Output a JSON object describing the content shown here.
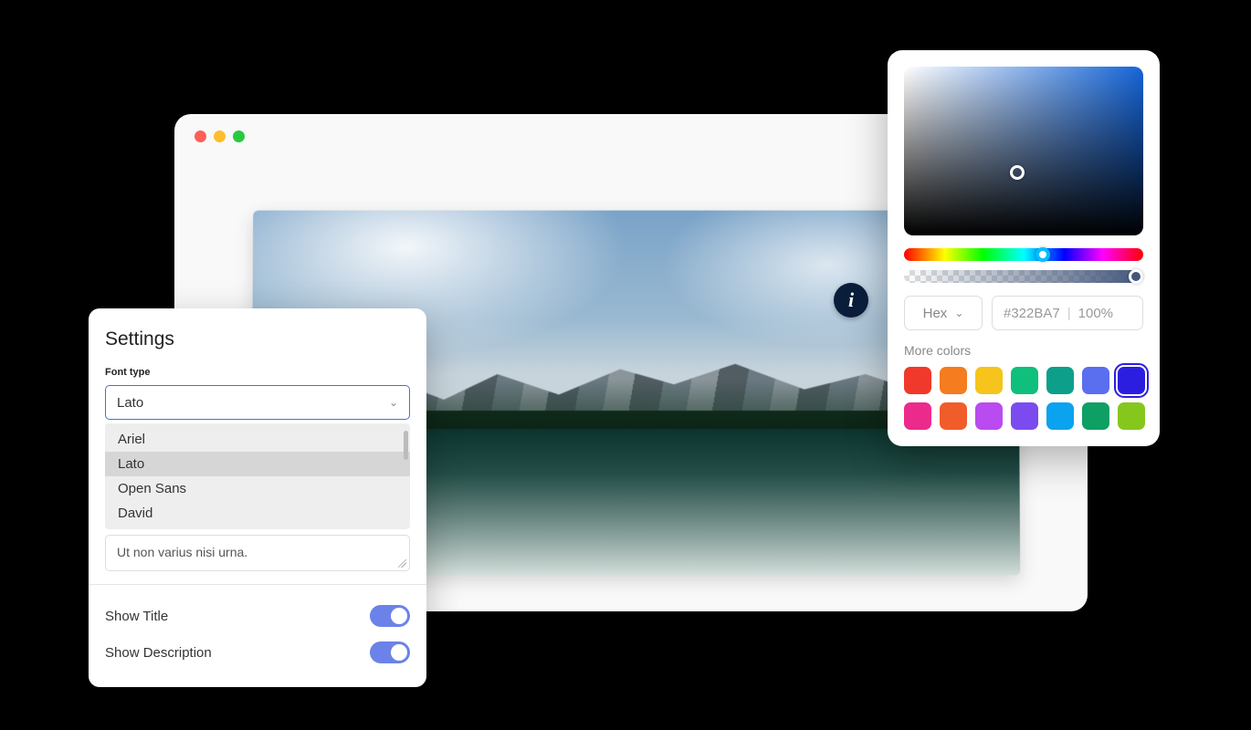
{
  "settings": {
    "title": "Settings",
    "font_type_label": "Font type",
    "font_selected": "Lato",
    "font_options": [
      "Ariel",
      "Lato",
      "Open Sans",
      "David"
    ],
    "textarea_value": "Ut non varius nisi urna.",
    "show_title_label": "Show Title",
    "show_title_on": true,
    "show_description_label": "Show Description",
    "show_description_on": true
  },
  "picker": {
    "format_label": "Hex",
    "hex_value": "#322BA7",
    "opacity": "100%",
    "more_colors_label": "More colors",
    "swatches_row1": [
      "#f0392b",
      "#f57c1f",
      "#f6c41b",
      "#0fbf7b",
      "#0e9f8b",
      "#5a6ef0",
      "#2b1ee0"
    ],
    "swatches_row2": [
      "#ec2a8c",
      "#f05d2a",
      "#b94bf0",
      "#7b4bf0",
      "#0ba2f0",
      "#0d9f63",
      "#86c71d"
    ],
    "selected_swatch_index": 6
  },
  "info_badge": "i"
}
